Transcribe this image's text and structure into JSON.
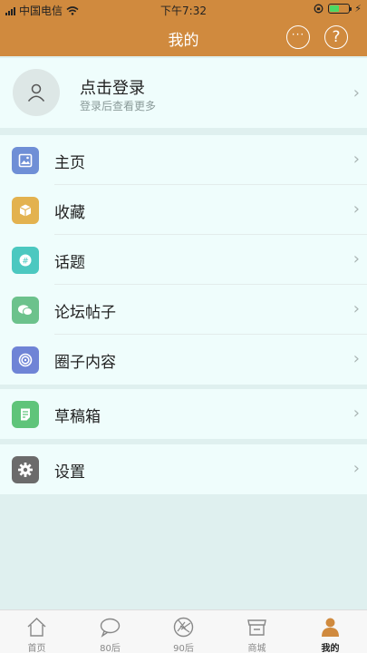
{
  "status_bar": {
    "carrier": "中国电信",
    "time": "下午7:32",
    "battery_level": 0.5
  },
  "header": {
    "title": "我的"
  },
  "login": {
    "title": "点击登录",
    "subtitle": "登录后查看更多"
  },
  "menu": [
    {
      "label": "主页",
      "icon": "image-icon",
      "color": "#6f8fd6"
    },
    {
      "label": "收藏",
      "icon": "box-icon",
      "color": "#e3b24f"
    },
    {
      "label": "话题",
      "icon": "hashtag-icon",
      "color": "#4cc8c0"
    },
    {
      "label": "论坛帖子",
      "icon": "chat-bubbles-icon",
      "color": "#6cc28c"
    },
    {
      "label": "圈子内容",
      "icon": "circle-swirl-icon",
      "color": "#6f84d6"
    }
  ],
  "drafts": {
    "label": "草稿箱",
    "icon": "document-icon",
    "color": "#5fc47a"
  },
  "settings": {
    "label": "设置",
    "icon": "gear-icon",
    "color": "#6b6b6b"
  },
  "tabs": [
    {
      "label": "首页",
      "icon": "home-icon",
      "active": false
    },
    {
      "label": "80后",
      "icon": "chat-icon",
      "active": false
    },
    {
      "label": "90后",
      "icon": "aperture-icon",
      "active": false
    },
    {
      "label": "商城",
      "icon": "store-icon",
      "active": false
    },
    {
      "label": "我的",
      "icon": "person-icon",
      "active": true
    }
  ],
  "colors": {
    "header": "#d08a3e",
    "active_tab": "#d08a3e",
    "background": "#dff0ef"
  }
}
